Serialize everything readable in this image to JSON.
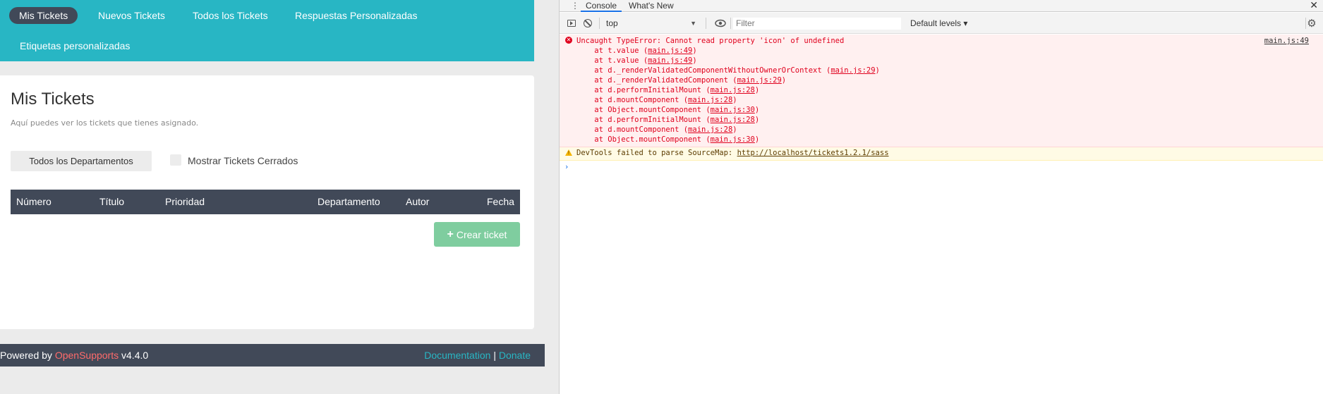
{
  "nav": {
    "items": [
      {
        "label": "Mis Tickets",
        "active": true
      },
      {
        "label": "Nuevos Tickets",
        "active": false
      },
      {
        "label": "Todos los Tickets",
        "active": false
      },
      {
        "label": "Respuestas Personalizadas",
        "active": false
      },
      {
        "label": "Etiquetas personalizadas",
        "active": false
      }
    ]
  },
  "main": {
    "title": "Mis Tickets",
    "description": "Aquí puedes ver los tickets que tienes asignado.",
    "department_button": "Todos los Departamentos",
    "show_closed_label": "Mostrar Tickets Cerrados",
    "show_closed_checked": false,
    "table_headers": [
      "Número",
      "Título",
      "Prioridad",
      "Departamento",
      "Autor",
      "Fecha"
    ],
    "create_button": "Crear ticket"
  },
  "footer": {
    "powered_prefix": "Powered by",
    "brand": "OpenSupports",
    "version": "v4.4.0",
    "documentation": "Documentation",
    "separator": "|",
    "donate": "Donate"
  },
  "devtools": {
    "menu_icon": "⋮",
    "tabs": [
      {
        "label": "Console",
        "active": true
      },
      {
        "label": "What's New",
        "active": false
      }
    ],
    "close_icon": "✕",
    "context": "top",
    "filter_placeholder": "Filter",
    "levels": "Default levels ▾",
    "error": {
      "message": "Uncaught TypeError: Cannot read property 'icon' of undefined",
      "source": "main.js:49",
      "stack": [
        {
          "text": "    at t.value (",
          "loc": "main.js:49",
          "end": ")"
        },
        {
          "text": "    at t.value (",
          "loc": "main.js:49",
          "end": ")"
        },
        {
          "text": "    at d._renderValidatedComponentWithoutOwnerOrContext (",
          "loc": "main.js:29",
          "end": ")"
        },
        {
          "text": "    at d._renderValidatedComponent (",
          "loc": "main.js:29",
          "end": ")"
        },
        {
          "text": "    at d.performInitialMount (",
          "loc": "main.js:28",
          "end": ")"
        },
        {
          "text": "    at d.mountComponent (",
          "loc": "main.js:28",
          "end": ")"
        },
        {
          "text": "    at Object.mountComponent (",
          "loc": "main.js:30",
          "end": ")"
        },
        {
          "text": "    at d.performInitialMount (",
          "loc": "main.js:28",
          "end": ")"
        },
        {
          "text": "    at d.mountComponent (",
          "loc": "main.js:28",
          "end": ")"
        },
        {
          "text": "    at Object.mountComponent (",
          "loc": "main.js:30",
          "end": ")"
        }
      ]
    },
    "warning": {
      "prefix": "DevTools failed to parse SourceMap: ",
      "url": "http://localhost/tickets1.2.1/sass"
    },
    "prompt": "›"
  }
}
